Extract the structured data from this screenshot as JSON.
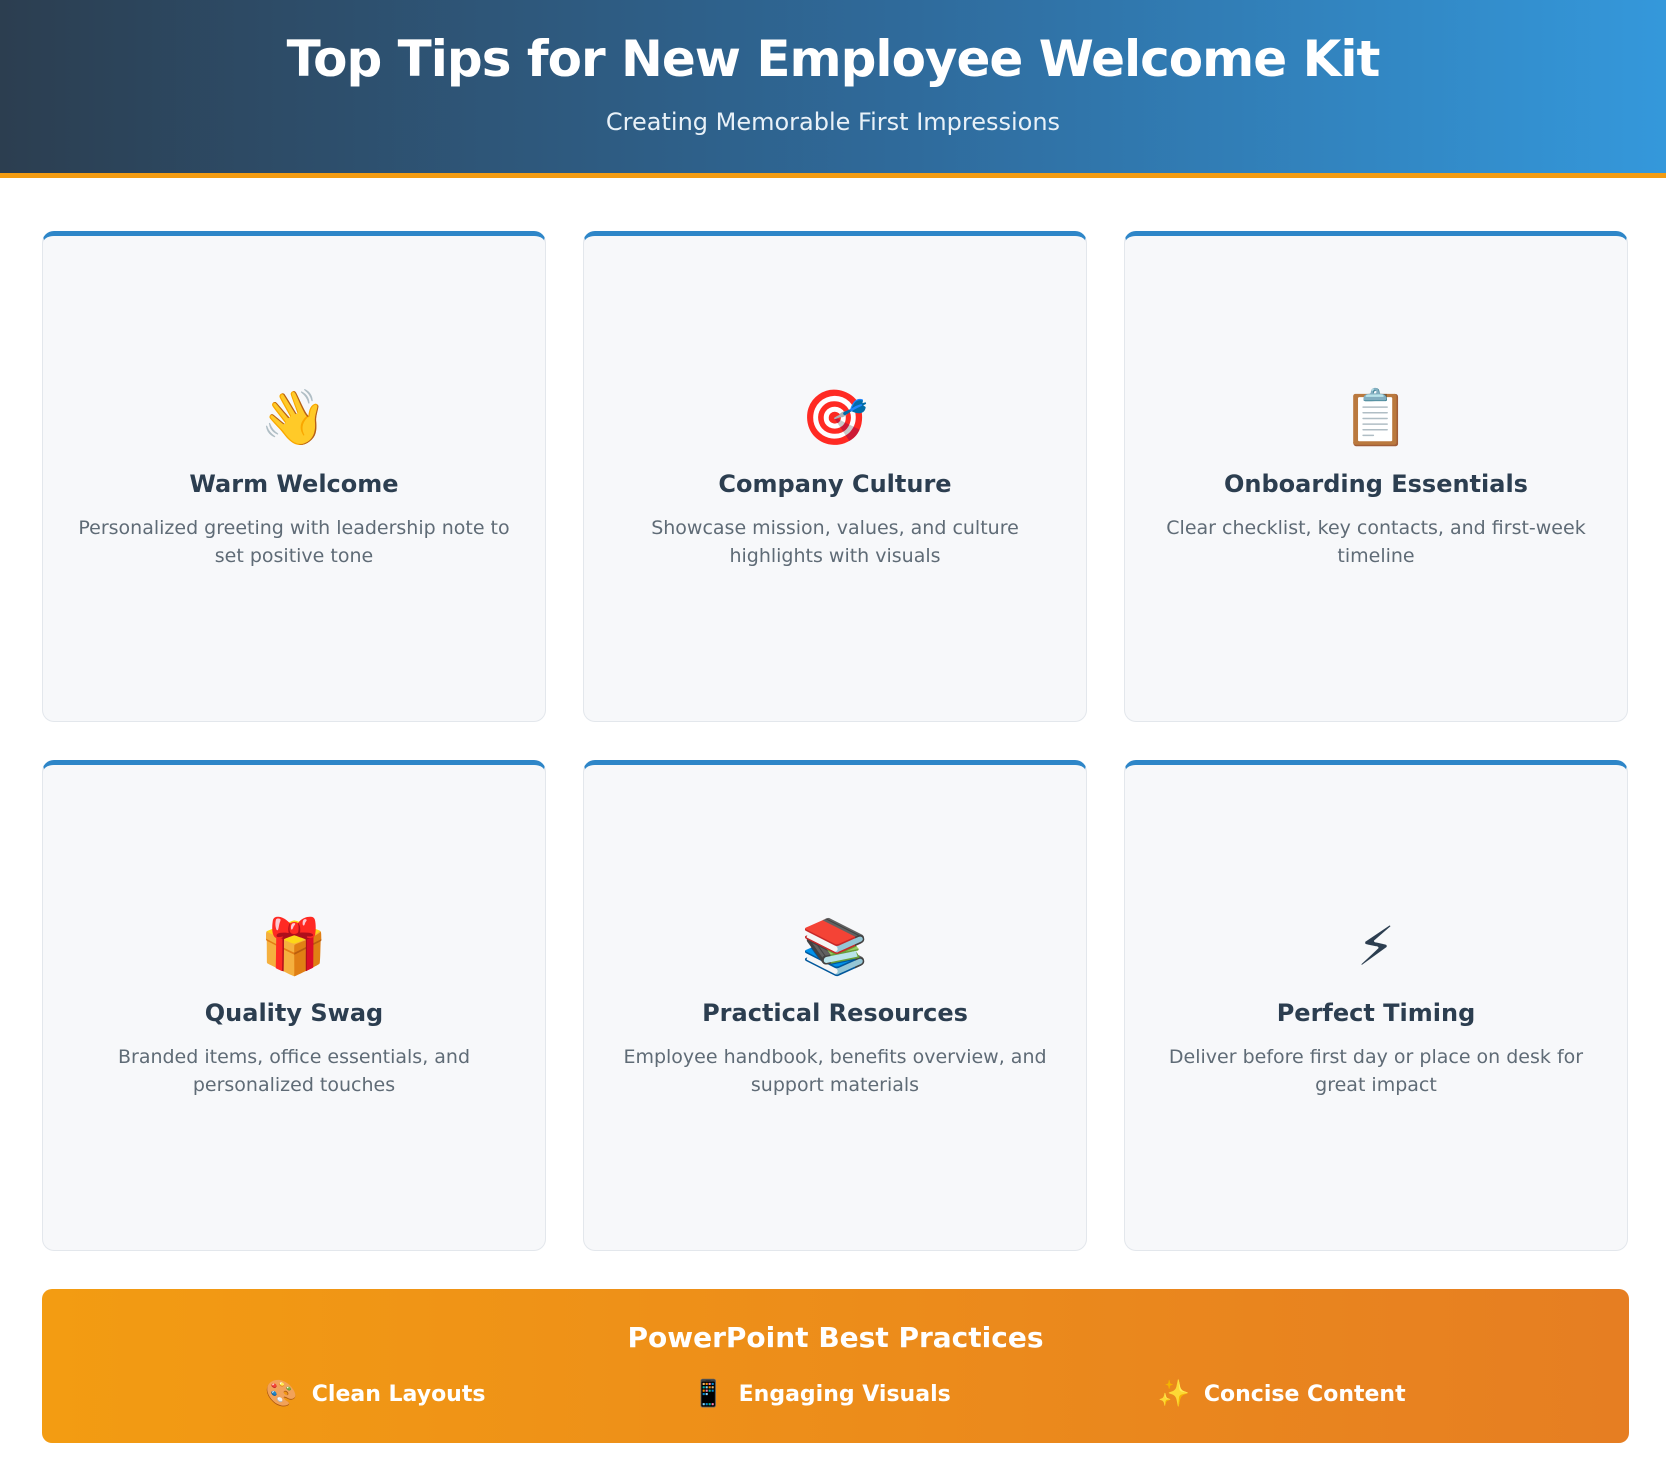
{
  "header": {
    "title": "Top Tips for New Employee Welcome Kit",
    "subtitle": "Creating Memorable First Impressions"
  },
  "cards": [
    {
      "icon": "👋",
      "icon_name": "waving-hand-icon",
      "title": "Warm Welcome",
      "desc": "Personalized greeting with leadership note to set positive tone"
    },
    {
      "icon": "🎯",
      "icon_name": "target-icon",
      "title": "Company Culture",
      "desc": "Showcase mission, values, and culture highlights with visuals"
    },
    {
      "icon": "📋",
      "icon_name": "clipboard-icon",
      "title": "Onboarding Essentials",
      "desc": "Clear checklist, key contacts, and first-week timeline"
    },
    {
      "icon": "🎁",
      "icon_name": "gift-icon",
      "title": "Quality Swag",
      "desc": "Branded items, office essentials, and personalized touches"
    },
    {
      "icon": "📚",
      "icon_name": "books-icon",
      "title": "Practical Resources",
      "desc": "Employee handbook, benefits overview, and support materials"
    },
    {
      "icon": "⚡",
      "icon_name": "lightning-icon",
      "title": "Perfect Timing",
      "desc": "Deliver before first day or place on desk for great impact"
    }
  ],
  "practices": {
    "title": "PowerPoint Best Practices",
    "items": [
      {
        "icon": "🎨",
        "icon_name": "palette-icon",
        "label": "Clean Layouts"
      },
      {
        "icon": "📱",
        "icon_name": "mobile-phone-icon",
        "label": "Engaging Visuals"
      },
      {
        "icon": "✨",
        "icon_name": "sparkles-icon",
        "label": "Concise Content"
      }
    ]
  },
  "colors": {
    "header_start": "#2c3e50",
    "header_end": "#3498db",
    "accent_orange": "#f39c12",
    "card_top_border": "#2e86c8",
    "card_background": "#f7f8fa"
  }
}
